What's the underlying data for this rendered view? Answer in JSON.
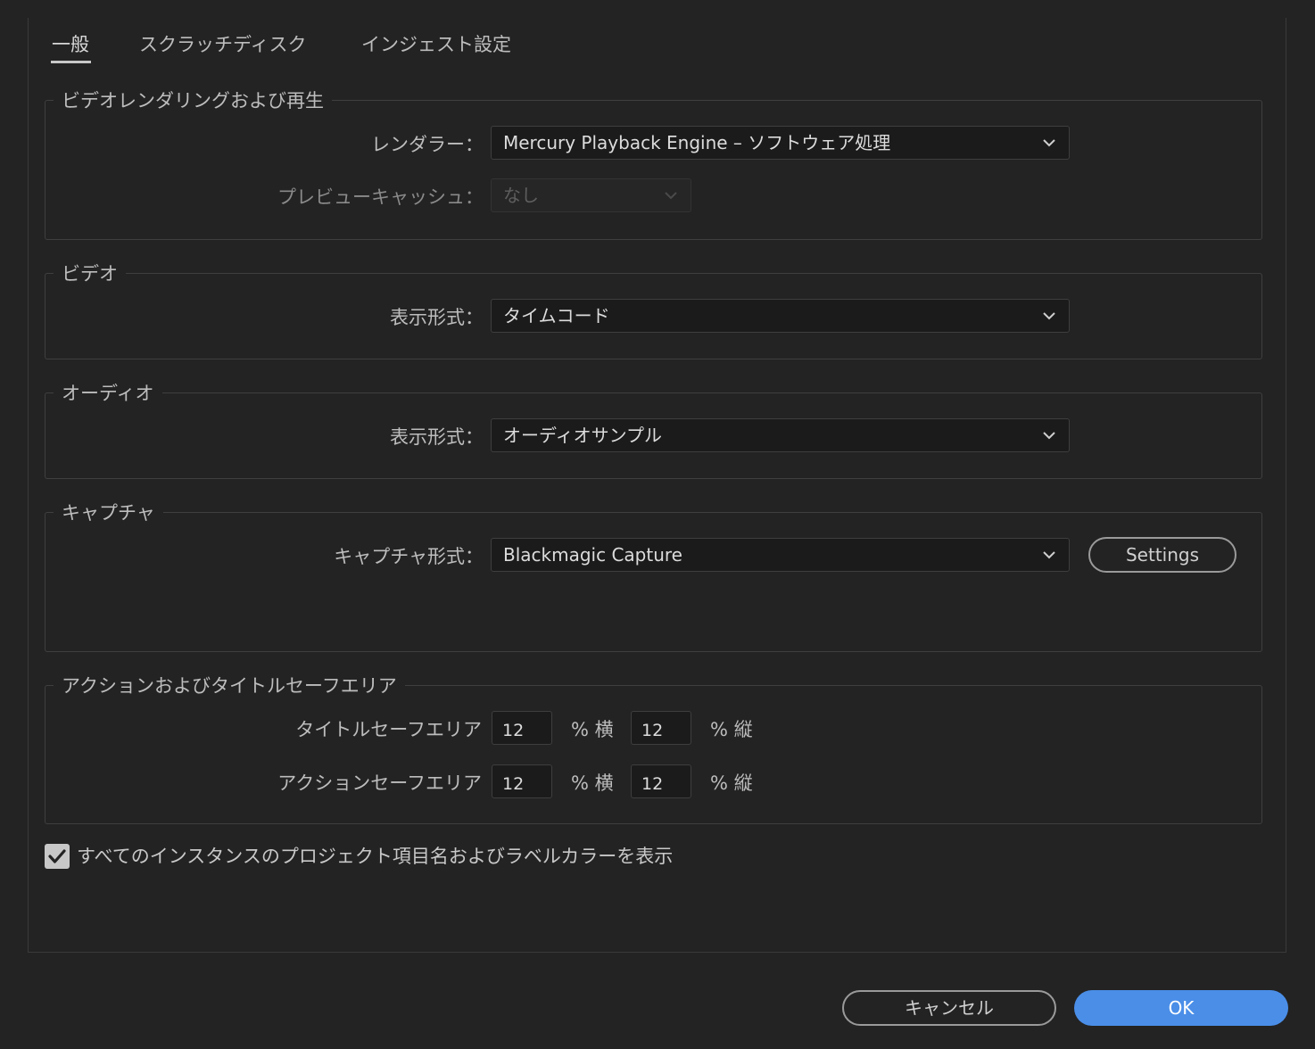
{
  "tabs": [
    {
      "label": "一般",
      "active": true
    },
    {
      "label": "スクラッチディスク",
      "active": false
    },
    {
      "label": "インジェスト設定",
      "active": false
    }
  ],
  "rendering": {
    "title": "ビデオレンダリングおよび再生",
    "renderer_label": "レンダラー：",
    "renderer_value": "Mercury Playback Engine – ソフトウェア処理",
    "preview_cache_label": "プレビューキャッシュ：",
    "preview_cache_value": "なし"
  },
  "video": {
    "title": "ビデオ",
    "display_format_label": "表示形式：",
    "display_format_value": "タイムコード"
  },
  "audio": {
    "title": "オーディオ",
    "display_format_label": "表示形式：",
    "display_format_value": "オーディオサンプル"
  },
  "capture": {
    "title": "キャプチャ",
    "format_label": "キャプチャ形式：",
    "format_value": "Blackmagic Capture",
    "settings_button": "Settings"
  },
  "safe_area": {
    "title": "アクションおよびタイトルセーフエリア",
    "title_safe_label": "タイトルセーフエリア",
    "title_safe_h": "12",
    "title_safe_v": "12",
    "action_safe_label": "アクションセーフエリア",
    "action_safe_h": "12",
    "action_safe_v": "12",
    "unit_h": "% 横",
    "unit_v": "% 縦"
  },
  "show_labels_checkbox": {
    "label": "すべてのインスタンスのプロジェクト項目名およびラベルカラーを表示",
    "checked": true
  },
  "footer": {
    "cancel_label": "キャンセル",
    "ok_label": "OK"
  },
  "colors": {
    "background": "#232323",
    "accent": "#4a8ee8"
  }
}
